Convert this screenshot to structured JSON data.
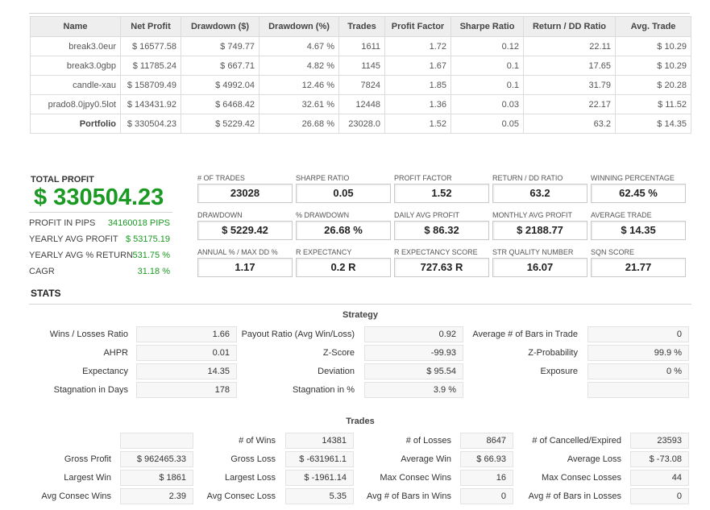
{
  "comparison": {
    "headers": [
      "Name",
      "Net Profit",
      "Drawdown ($)",
      "Drawdown (%)",
      "Trades",
      "Profit Factor",
      "Sharpe Ratio",
      "Return / DD Ratio",
      "Avg. Trade"
    ],
    "rows": [
      [
        "break3.0eur",
        "$ 16577.58",
        "$ 749.77",
        "4.67 %",
        "1611",
        "1.72",
        "0.12",
        "22.11",
        "$ 10.29"
      ],
      [
        "break3.0gbp",
        "$ 11785.24",
        "$ 667.71",
        "4.82 %",
        "1145",
        "1.67",
        "0.1",
        "17.65",
        "$ 10.29"
      ],
      [
        "candle-xau",
        "$ 158709.49",
        "$ 4992.04",
        "12.46 %",
        "7824",
        "1.85",
        "0.1",
        "31.79",
        "$ 20.28"
      ],
      [
        "prado8.0jpy0.5lot",
        "$ 143431.92",
        "$ 6468.42",
        "32.61 %",
        "12448",
        "1.36",
        "0.03",
        "22.17",
        "$ 11.52"
      ],
      [
        "Portfolio",
        "$ 330504.23",
        "$ 5229.42",
        "26.68 %",
        "23028.0",
        "1.52",
        "0.05",
        "63.2",
        "$ 14.35"
      ]
    ]
  },
  "summary": {
    "title": "TOTAL PROFIT",
    "total_profit": "$ 330504.23",
    "rows": [
      {
        "label": "PROFIT IN PIPS",
        "value": "34160018 PIPS"
      },
      {
        "label": "YEARLY AVG PROFIT",
        "value": "$ 53175.19"
      },
      {
        "label": "YEARLY AVG % RETURN",
        "value": "531.75 %"
      },
      {
        "label": "CAGR",
        "value": "31.18 %"
      }
    ]
  },
  "metrics": [
    {
      "label": "# OF TRADES",
      "value": "23028"
    },
    {
      "label": "SHARPE RATIO",
      "value": "0.05"
    },
    {
      "label": "PROFIT FACTOR",
      "value": "1.52"
    },
    {
      "label": "RETURN / DD RATIO",
      "value": "63.2"
    },
    {
      "label": "WINNING PERCENTAGE",
      "value": "62.45 %"
    },
    {
      "label": "DRAWDOWN",
      "value": "$ 5229.42"
    },
    {
      "label": "% DRAWDOWN",
      "value": "26.68 %"
    },
    {
      "label": "DAILY AVG PROFIT",
      "value": "$ 86.32"
    },
    {
      "label": "MONTHLY AVG PROFIT",
      "value": "$ 2188.77"
    },
    {
      "label": "AVERAGE TRADE",
      "value": "$ 14.35"
    },
    {
      "label": "ANNUAL % / MAX DD %",
      "value": "1.17"
    },
    {
      "label": "R EXPECTANCY",
      "value": "0.2 R"
    },
    {
      "label": "R EXPECTANCY SCORE",
      "value": "727.63 R"
    },
    {
      "label": "STR QUALITY NUMBER",
      "value": "16.07"
    },
    {
      "label": "SQN SCORE",
      "value": "21.77"
    }
  ],
  "stats": {
    "heading": "STATS",
    "strategy": {
      "heading": "Strategy",
      "items": [
        {
          "label": "Wins / Losses Ratio",
          "value": "1.66"
        },
        {
          "label": "Payout Ratio (Avg Win/Loss)",
          "value": "0.92"
        },
        {
          "label": "Average # of Bars in Trade",
          "value": "0"
        },
        {
          "label": "AHPR",
          "value": "0.01"
        },
        {
          "label": "Z-Score",
          "value": "-99.93"
        },
        {
          "label": "Z-Probability",
          "value": "99.9 %"
        },
        {
          "label": "Expectancy",
          "value": "14.35"
        },
        {
          "label": "Deviation",
          "value": "$ 95.54"
        },
        {
          "label": "Exposure",
          "value": "0 %"
        },
        {
          "label": "Stagnation in Days",
          "value": "178"
        },
        {
          "label": "Stagnation in %",
          "value": "3.9 %"
        },
        {
          "label": "",
          "value": ""
        }
      ]
    },
    "trades": {
      "heading": "Trades",
      "items": [
        {
          "label": "",
          "value": ""
        },
        {
          "label": "# of Wins",
          "value": "14381"
        },
        {
          "label": "# of Losses",
          "value": "8647"
        },
        {
          "label": "# of Cancelled/Expired",
          "value": "23593"
        },
        {
          "label": "Gross Profit",
          "value": "$ 962465.33"
        },
        {
          "label": "Gross Loss",
          "value": "$ -631961.1"
        },
        {
          "label": "Average Win",
          "value": "$ 66.93"
        },
        {
          "label": "Average Loss",
          "value": "$ -73.08"
        },
        {
          "label": "Largest Win",
          "value": "$ 1861"
        },
        {
          "label": "Largest Loss",
          "value": "$ -1961.14"
        },
        {
          "label": "Max Consec Wins",
          "value": "16"
        },
        {
          "label": "Max Consec Losses",
          "value": "44"
        },
        {
          "label": "Avg Consec Wins",
          "value": "2.39"
        },
        {
          "label": "Avg Consec Loss",
          "value": "5.35"
        },
        {
          "label": "Avg # of Bars in Wins",
          "value": "0"
        },
        {
          "label": "Avg # of Bars in Losses",
          "value": "0"
        }
      ]
    }
  }
}
